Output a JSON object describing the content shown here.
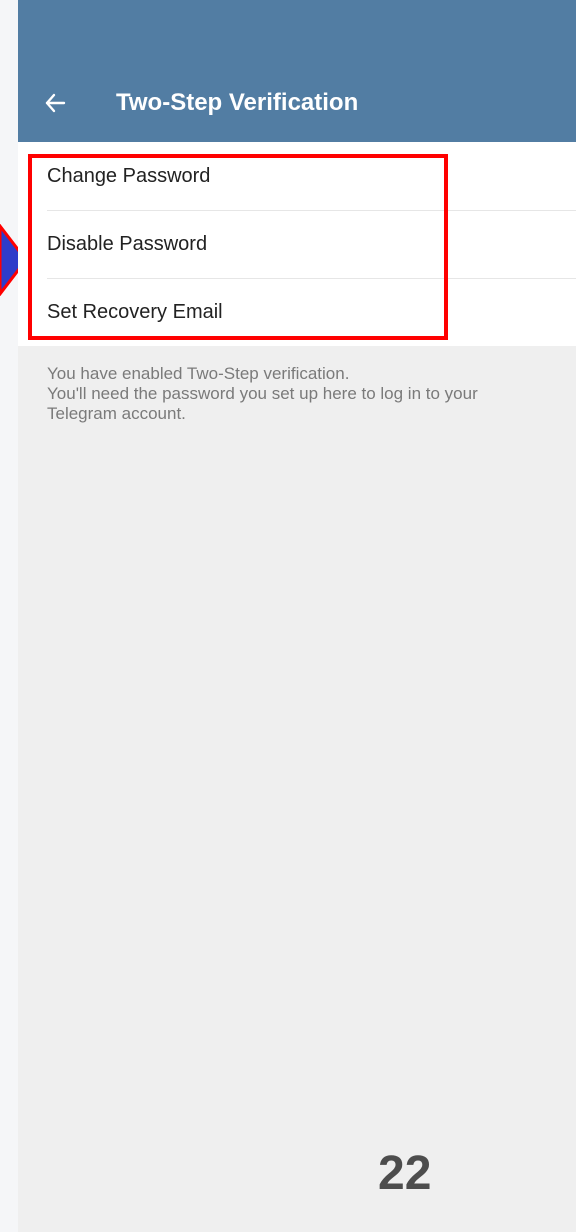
{
  "app_bar": {
    "title": "Two-Step Verification",
    "color": "#527da3",
    "back_icon": "arrow-left-icon"
  },
  "menu": {
    "items": [
      {
        "label": "Change Password"
      },
      {
        "label": "Disable Password"
      },
      {
        "label": "Set Recovery Email"
      }
    ]
  },
  "info": {
    "lines": [
      "You have enabled Two-Step verification.",
      "You'll need the password you set up here to log in to your",
      "Telegram account."
    ]
  },
  "annotations": {
    "highlight_color": "#ff0000",
    "arrow_fill": "#2f3cc9",
    "arrow_border": "#ff0000"
  },
  "page_number": "22"
}
